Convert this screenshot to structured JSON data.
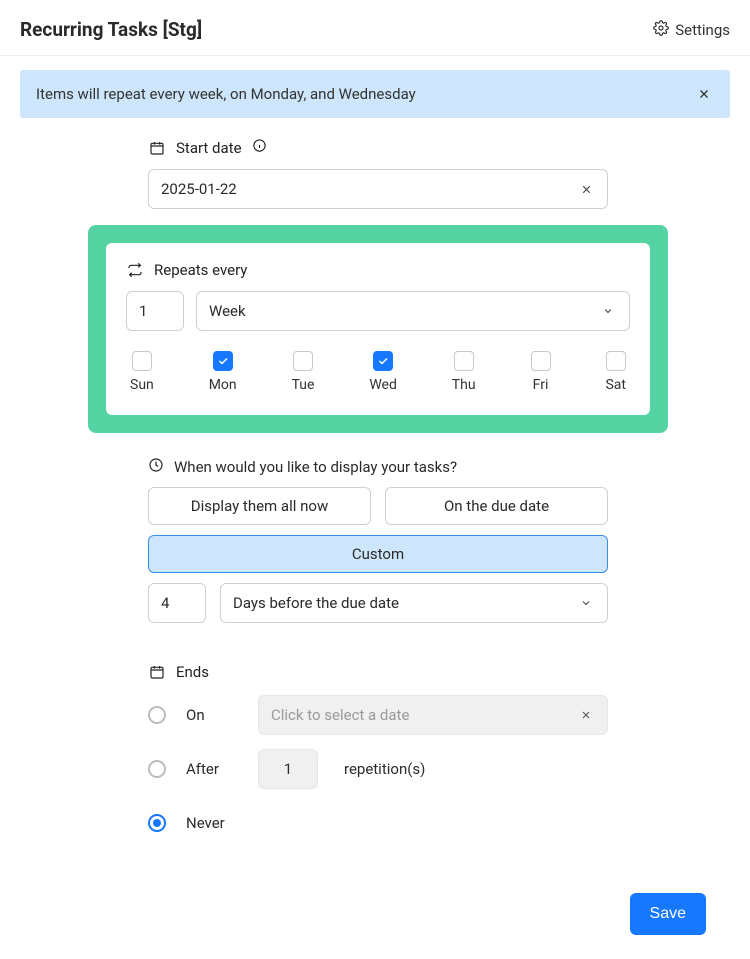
{
  "header": {
    "title": "Recurring Tasks [Stg]",
    "settings_label": "Settings"
  },
  "banner": {
    "text": "Items will repeat every week, on Monday, and Wednesday"
  },
  "start_date": {
    "label": "Start date",
    "value": "2025-01-22"
  },
  "repeats": {
    "label": "Repeats every",
    "count": "1",
    "unit": "Week",
    "days": [
      {
        "key": "sun",
        "label": "Sun",
        "checked": false
      },
      {
        "key": "mon",
        "label": "Mon",
        "checked": true
      },
      {
        "key": "tue",
        "label": "Tue",
        "checked": false
      },
      {
        "key": "wed",
        "label": "Wed",
        "checked": true
      },
      {
        "key": "thu",
        "label": "Thu",
        "checked": false
      },
      {
        "key": "fri",
        "label": "Fri",
        "checked": false
      },
      {
        "key": "sat",
        "label": "Sat",
        "checked": false
      }
    ]
  },
  "display": {
    "label": "When would you like to display your tasks?",
    "opt_all": "Display them all now",
    "opt_due": "On the due date",
    "opt_custom": "Custom",
    "custom_count": "4",
    "custom_unit": "Days before the due date"
  },
  "ends": {
    "label": "Ends",
    "on": {
      "label": "On",
      "placeholder": "Click to select a date"
    },
    "after": {
      "label": "After",
      "count": "1",
      "suffix": "repetition(s)"
    },
    "never": {
      "label": "Never"
    }
  },
  "actions": {
    "save": "Save"
  }
}
